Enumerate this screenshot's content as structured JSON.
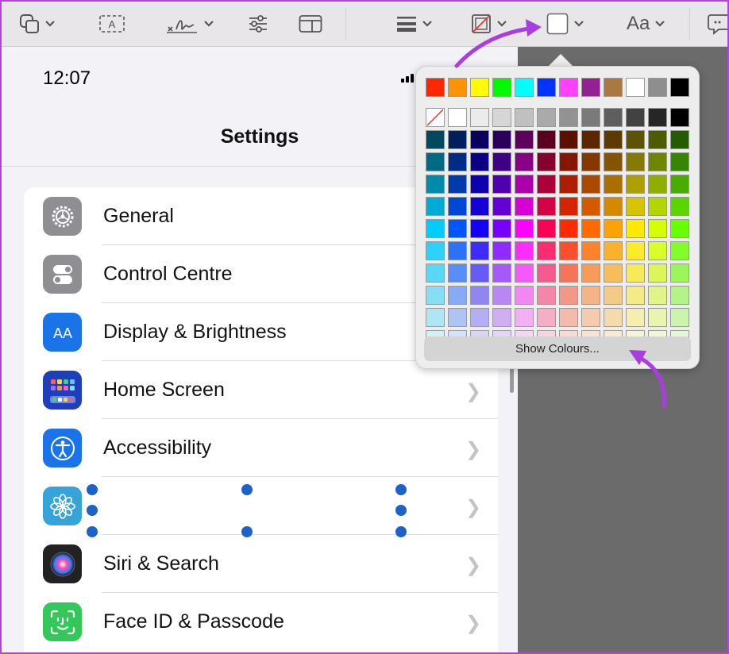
{
  "toolbar": {
    "tools": [
      "shapes-icon",
      "text-box-icon",
      "sign-icon",
      "adjust-icon",
      "sidebar-icon",
      "line-style-icon",
      "border-color-icon",
      "fill-color-icon",
      "text-style-icon",
      "comment-icon"
    ],
    "text_style_label": "Aa"
  },
  "phone": {
    "time": "12:07",
    "title": "Settings",
    "items": [
      {
        "label": "General",
        "icon": "gear-icon",
        "color": "#8e8e93"
      },
      {
        "label": "Control Centre",
        "icon": "toggles-icon",
        "color": "#8e8e93"
      },
      {
        "label": "Display & Brightness",
        "icon": "text-size-icon",
        "color": "#1a73e8"
      },
      {
        "label": "Home Screen",
        "icon": "home-grid-icon",
        "color": "#1f3fb8"
      },
      {
        "label": "Accessibility",
        "icon": "accessibility-icon",
        "color": "#1a73e8"
      },
      {
        "label": "",
        "icon": "wallpaper-flower-icon",
        "color": "#36a3d9"
      },
      {
        "label": "Siri & Search",
        "icon": "siri-icon",
        "color": "#222222"
      },
      {
        "label": "Face ID & Passcode",
        "icon": "face-id-icon",
        "color": "#34c759"
      }
    ]
  },
  "color_picker": {
    "row1": [
      "#ff2600",
      "#ff9300",
      "#fffb00",
      "#00f900",
      "#00fdff",
      "#0433ff",
      "#ff40ff",
      "#942192",
      "#aa7942",
      "#ffffff",
      "#8e8e8e",
      "#000000"
    ],
    "row2": [
      "none",
      "#ffffff",
      "#ebebeb",
      "#d6d6d6",
      "#c0c0c0",
      "#aaaaaa",
      "#929292",
      "#7a7a7a",
      "#5e5e5e",
      "#424242",
      "#262626",
      "#000000"
    ],
    "show_colours_label": "Show Colours..."
  },
  "colors": {
    "accent_purple": "#b146d6",
    "selection_blue": "#1b63c6"
  }
}
